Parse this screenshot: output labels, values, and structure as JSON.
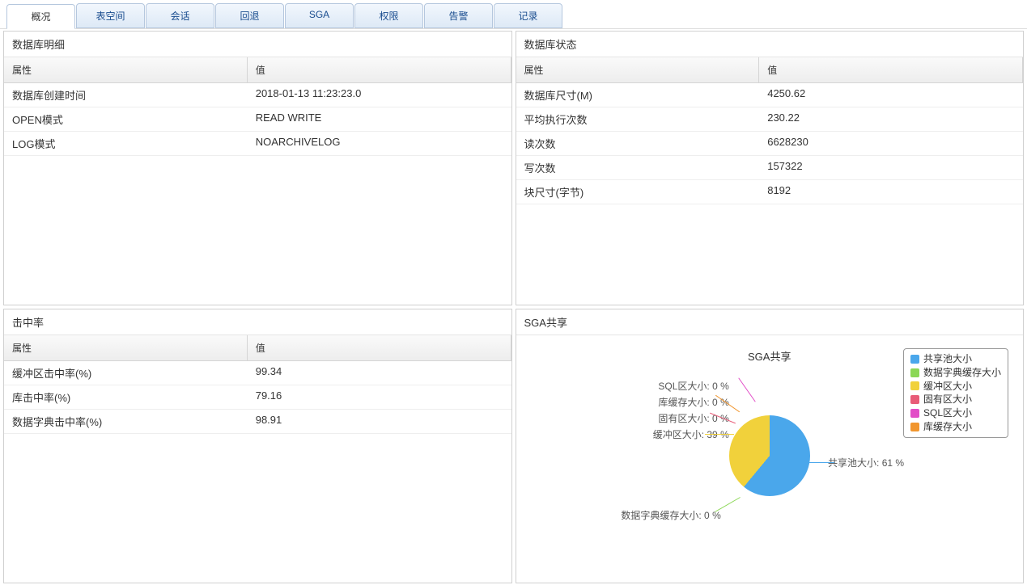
{
  "tabs": [
    "概况",
    "表空间",
    "会话",
    "回退",
    "SGA",
    "权限",
    "告警",
    "记录"
  ],
  "panel_db_detail": {
    "title": "数据库明细",
    "head_attr": "属性",
    "head_val": "值",
    "rows": [
      {
        "attr": "数据库创建时间",
        "val": "2018-01-13 11:23:23.0"
      },
      {
        "attr": "OPEN模式",
        "val": "READ WRITE"
      },
      {
        "attr": "LOG模式",
        "val": "NOARCHIVELOG"
      }
    ]
  },
  "panel_db_status": {
    "title": "数据库状态",
    "head_attr": "属性",
    "head_val": "值",
    "rows": [
      {
        "attr": "数据库尺寸(M)",
        "val": "4250.62"
      },
      {
        "attr": "平均执行次数",
        "val": "230.22"
      },
      {
        "attr": "读次数",
        "val": "6628230"
      },
      {
        "attr": "写次数",
        "val": "157322"
      },
      {
        "attr": "块尺寸(字节)",
        "val": "8192"
      }
    ]
  },
  "panel_hit": {
    "title": "击中率",
    "head_attr": "属性",
    "head_val": "值",
    "rows": [
      {
        "attr": "缓冲区击中率(%)",
        "val": "99.34"
      },
      {
        "attr": "库击中率(%)",
        "val": "79.16"
      },
      {
        "attr": "数据字典击中率(%)",
        "val": "98.91"
      }
    ]
  },
  "panel_sga": {
    "title": "SGA共享",
    "chart_title": "SGA共享",
    "legend": [
      {
        "name": "共享池大小",
        "color": "#4aa7eb"
      },
      {
        "name": "数据字典缓存大小",
        "color": "#8bd756"
      },
      {
        "name": "缓冲区大小",
        "color": "#f1d13b"
      },
      {
        "name": "固有区大小",
        "color": "#e85c78"
      },
      {
        "name": "SQL区大小",
        "color": "#e24dc7"
      },
      {
        "name": "库缓存大小",
        "color": "#f1962e"
      }
    ],
    "labels": {
      "shared_pool": "共享池大小: 61 %",
      "dict_cache": "数据字典缓存大小: 0 %",
      "buffer": "缓冲区大小: 39 %",
      "fixed": "固有区大小: 0 %",
      "sql": "SQL区大小: 0 %",
      "lib_cache": "库缓存大小: 0 %"
    }
  },
  "chart_data": {
    "type": "pie",
    "title": "SGA共享",
    "series": [
      {
        "name": "共享池大小",
        "value": 61,
        "color": "#4aa7eb"
      },
      {
        "name": "数据字典缓存大小",
        "value": 0,
        "color": "#8bd756"
      },
      {
        "name": "缓冲区大小",
        "value": 39,
        "color": "#f1d13b"
      },
      {
        "name": "固有区大小",
        "value": 0,
        "color": "#e85c78"
      },
      {
        "name": "SQL区大小",
        "value": 0,
        "color": "#e24dc7"
      },
      {
        "name": "库缓存大小",
        "value": 0,
        "color": "#f1962e"
      }
    ]
  }
}
